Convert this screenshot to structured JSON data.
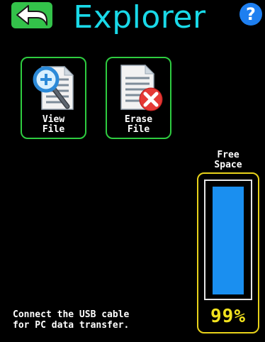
{
  "header": {
    "title": "Explorer",
    "help_label": "?"
  },
  "tiles": [
    {
      "label": "View\nFile",
      "icon": "magnifier-document-icon"
    },
    {
      "label": "Erase\nFile",
      "icon": "delete-document-icon"
    }
  ],
  "free_space": {
    "label": "Free\nSpace",
    "percent_text": "99%",
    "level": 0.99
  },
  "footer": {
    "message": "Connect the USB cable\nfor PC data transfer."
  },
  "colors": {
    "background": "#000000",
    "title": "#19d9e8",
    "back_button": "#33c24a",
    "help_button": "#1e7ff0",
    "tile_border": "#2ecc40",
    "gauge_border": "#e8d21a",
    "gauge_fill": "#1a8ff0",
    "percent_text": "#f2e21e"
  }
}
